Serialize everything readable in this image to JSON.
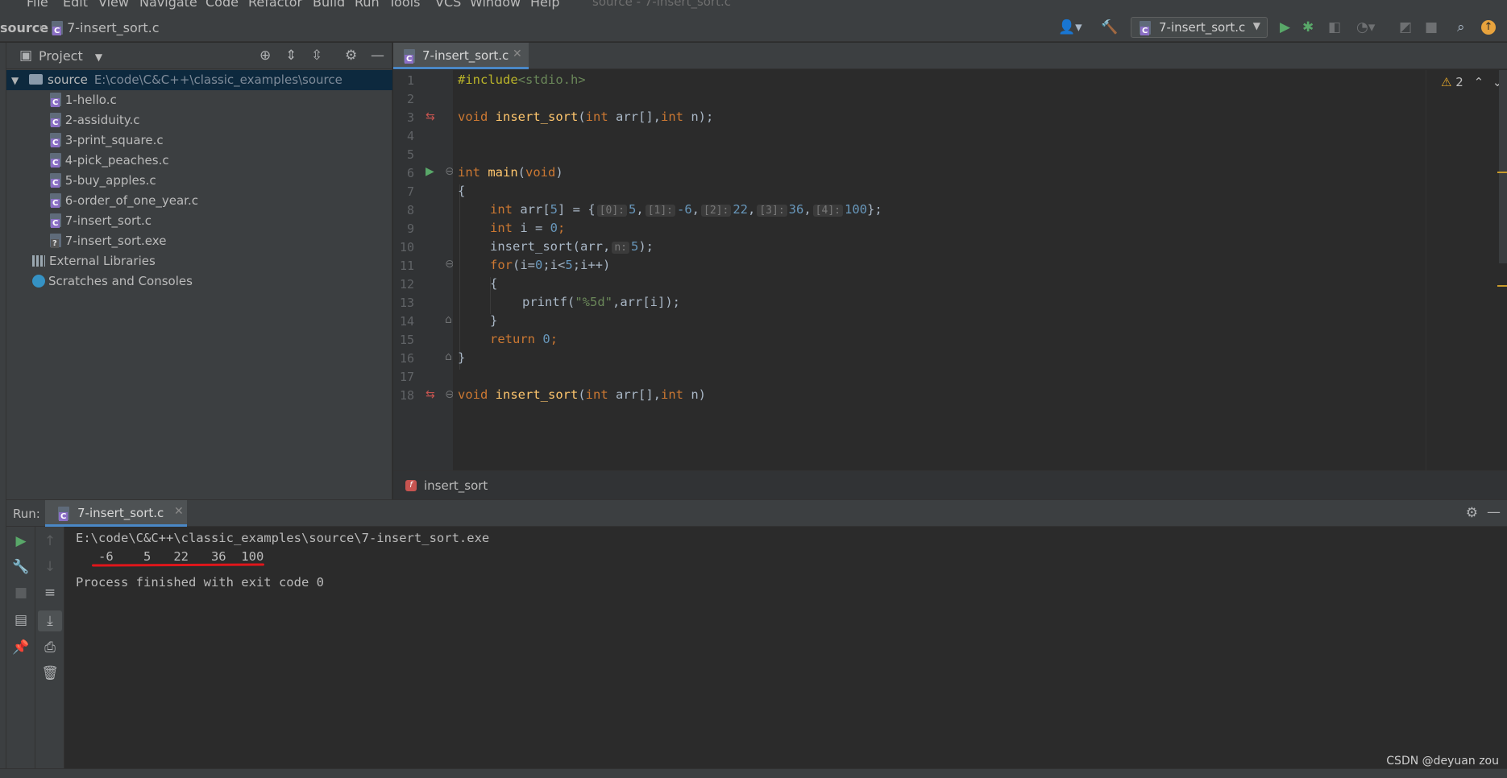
{
  "menu": [
    "File",
    "Edit",
    "View",
    "Navigate",
    "Code",
    "Refactor",
    "Build",
    "Run",
    "Tools",
    "VCS",
    "Window",
    "Help"
  ],
  "window_title": "source - 7-insert_sort.c",
  "navbar": {
    "crumb_root": "source",
    "crumb_file": "7-insert_sort.c",
    "run_config": "7-insert_sort.c"
  },
  "project": {
    "title": "Project",
    "root_name": "source",
    "root_path": "E:\\code\\C&C++\\classic_examples\\source",
    "files": [
      "1-hello.c",
      "2-assiduity.c",
      "3-print_square.c",
      "4-pick_peaches.c",
      "5-buy_apples.c",
      "6-order_of_one_year.c",
      "7-insert_sort.c",
      "7-insert_sort.exe"
    ],
    "external_libraries": "External Libraries",
    "scratches": "Scratches and Consoles"
  },
  "editor": {
    "tab_label": "7-insert_sort.c",
    "warnings_count": "2",
    "line_numbers": [
      "1",
      "2",
      "3",
      "4",
      "5",
      "6",
      "7",
      "8",
      "9",
      "10",
      "11",
      "12",
      "13",
      "14",
      "15",
      "16",
      "17",
      "18"
    ],
    "code": {
      "l1_pp": "#include",
      "l1_hdr": "<stdio.h>",
      "l3_kw": "void",
      "l3_fn": "insert_sort",
      "l3_args_a": "(",
      "l3_int1": "int",
      "l3_args_b": " arr[],",
      "l3_int2": "int",
      "l3_args_c": " n);",
      "l6_kw": "int",
      "l6_fn": "main",
      "l6_paren_a": "(",
      "l6_void": "void",
      "l6_paren_b": ")",
      "l7": "{",
      "l8_kw": "int",
      "l8_a": " arr[",
      "l8_n": "5",
      "l8_b": "] = {",
      "l8_h0": "[0]:",
      "l8_v0": "5",
      "l8_h1": "[1]:",
      "l8_v1": "-6",
      "l8_h2": "[2]:",
      "l8_v2": "22",
      "l8_h3": "[3]:",
      "l8_v3": "36",
      "l8_h4": "[4]:",
      "l8_v4": "100",
      "l8_end": "};",
      "l9_kw": "int",
      "l9_a": " i = ",
      "l9_n": "0",
      "l9_end": ";",
      "l10_a": "insert_sort(arr,",
      "l10_hint": "n:",
      "l10_n": "5",
      "l10_end": ");",
      "l11_kw": "for",
      "l11_a": "(i=",
      "l11_n0": "0",
      "l11_b": ";i<",
      "l11_n5": "5",
      "l11_c": ";i++)",
      "l12": "{",
      "l13_a": "printf(",
      "l13_str": "\"%5d\"",
      "l13_b": ",arr[i]);",
      "l14": "}",
      "l15_kw": "return",
      "l15_n": "0",
      "l15_end": ";",
      "l16": "}",
      "l18_kw": "void",
      "l18_fn": "insert_sort",
      "l18_a": "(",
      "l18_int1": "int",
      "l18_b": " arr[],",
      "l18_int2": "int",
      "l18_c": " n)"
    },
    "breadcrumb_function": "insert_sort",
    "breadcrumb_badge": "f"
  },
  "run": {
    "label": "Run:",
    "tab_label": "7-insert_sort.c",
    "console_lines": [
      "E:\\code\\C&C++\\classic_examples\\source\\7-insert_sort.exe",
      "   -6    5   22   36  100",
      "",
      "Process finished with exit code 0"
    ]
  },
  "watermark": "CSDN @deyuan zou",
  "colors": {
    "accent": "#4a88c7",
    "keyword": "#cc7832",
    "function": "#ffc66d",
    "number": "#6897bb",
    "string": "#6a8759",
    "highlight_underline": "#e0161b"
  }
}
